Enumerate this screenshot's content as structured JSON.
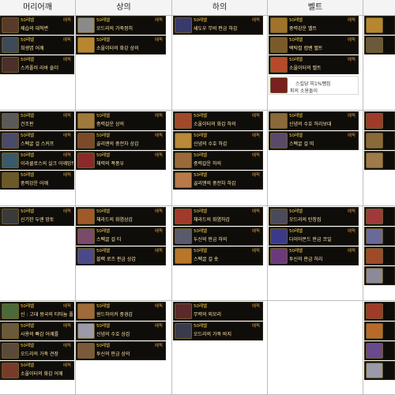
{
  "columns": [
    "머리어깨",
    "상의",
    "하의",
    "벨트",
    ""
  ],
  "common": {
    "tier": "50레벨",
    "rarity": "에픽"
  },
  "cells": {
    "c0r0": [
      "제습의 대척변",
      "희생엽 어깨",
      "스카폴러 라바 숄더"
    ],
    "c1r0": [
      "오드리의 가죽정히",
      "소울이터의 화강 상의"
    ],
    "c2r0": [
      "새도우 무비 판금 하갑"
    ],
    "c3r0": [
      "중력강운 벨트",
      "택틱컬 컴밴 벨트",
      "소울이터의 벨트"
    ],
    "c3r0_extra": "스킬당 피1%뺌집",
    "c3r0_extra2": "피의 소용돌이",
    "c0r1": [
      "건조판",
      "스펙굴 걸 스커프",
      "이라쿨로스의 실크 어깨망토",
      "중력강운 어깨"
    ],
    "c1r1": [
      "중력갈운 상의",
      "골리앤의 중전차 상갑",
      "채력의 폭풍우"
    ],
    "c2r1": [
      "소울이터의 화갑 하의",
      "신념의 수호 하갑",
      "중력갈운 하의",
      "골리앤의 중전차 하갑"
    ],
    "c3r1": [
      "신념의 수호 허리보대",
      "스펙굴 걸 띠"
    ],
    "c0r2": [
      "신기한 두엔 망토"
    ],
    "c1r2": [
      "채라드의 화염상갑",
      "스펙굴 걸 티",
      "블랙 로즈 판금 상갑"
    ],
    "c2r2": [
      "채라드의 화염하갑",
      "두신의 판금 하의",
      "스펙굴 걸 숏"
    ],
    "c3r2": [
      "오드리의 탄창집",
      "다이아몬드 판금 코일",
      "투신의 판금 허리"
    ],
    "c0r3": [
      "신 : 고대 왕국의 티타늄 폴드론",
      "사용의 빠갑 어깨를",
      "오드리의 가죽 견장",
      "소울이터의 화갑 어깨"
    ],
    "c1r3": [
      "윈드하이커 중경갑",
      "신념의 수호 상갑",
      "투신의 판금 상의"
    ],
    "c2r3": [
      "무력의 외모리",
      "오드리의 가죽 바지"
    ]
  }
}
